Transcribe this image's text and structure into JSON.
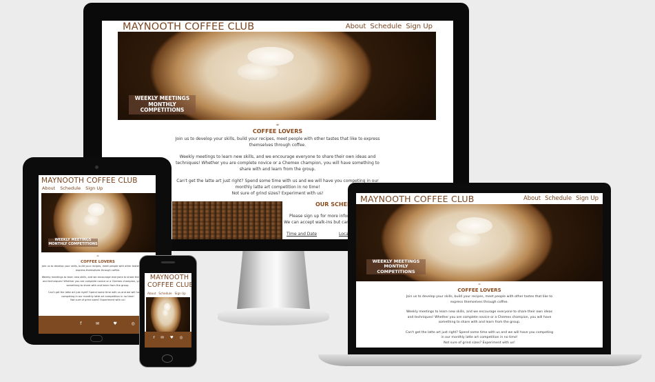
{
  "site": {
    "title": "MAYNOOTH COFFEE CLUB",
    "title_line1": "MAYNOOTH",
    "title_line2": "COFFEE CLUB",
    "nav": [
      "About",
      "Schedule",
      "Sign Up"
    ],
    "hero": {
      "line1": "WEEKLY MEETINGS",
      "line2": "MONTHLY COMPETITIONS"
    },
    "section_heading": "COFFEE LOVERS",
    "para1": "Join us to develop your skills, build your recipes, meet people with other tastes that like to express themselves through coffee.",
    "para2": "Weekly meetings to learn new skills, and we encourage everyone to share their own ideas and techniques! Whether you are complete novice or a Chemex champion, you will have something to share with and learn from the group.",
    "para3": "Can't get the latte art just right? Spend some time with us and we will have you competing in our monthly latte art competition in no time!",
    "para4": "Not sure of grind sizes? Experiment with us!",
    "schedule_heading": "OUR SCHEDULE",
    "schedule_text1": "Please sign up for more information",
    "schedule_text2": "We can accept walk-ins but can pr",
    "table_headers": [
      "Time and Date",
      "Loca"
    ],
    "social": [
      "f",
      "✉",
      "♥",
      "◎"
    ]
  },
  "colors": {
    "brand": "#7a4520",
    "footer": "#7d4a22"
  }
}
